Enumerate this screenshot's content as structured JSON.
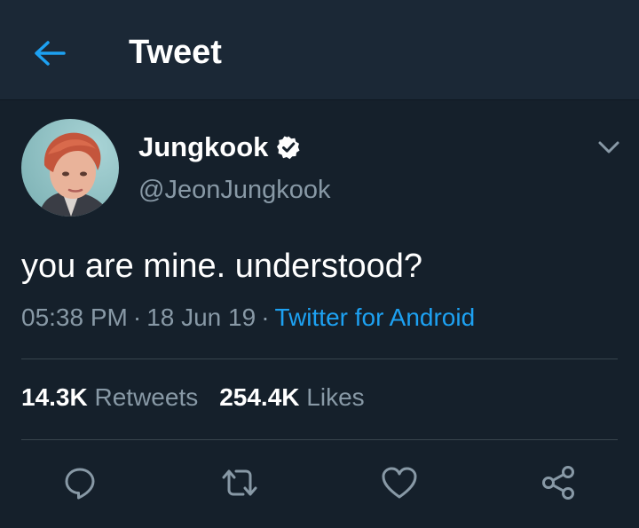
{
  "header": {
    "title": "Tweet",
    "back_icon": "arrow-left-icon"
  },
  "tweet": {
    "author": {
      "display_name": "Jungkook",
      "handle": "@JeonJungkook",
      "verified": true
    },
    "text": "you are mine. understood?",
    "time": "05:38 PM",
    "date": "18 Jun 19",
    "separator": "·",
    "source": "Twitter for Android",
    "stats": {
      "retweets_count": "14.3K",
      "retweets_label": "Retweets",
      "likes_count": "254.4K",
      "likes_label": "Likes"
    }
  },
  "actions": [
    "reply-icon",
    "retweet-icon",
    "like-icon",
    "share-icon"
  ],
  "colors": {
    "background": "#15202b",
    "header_background": "#1b2836",
    "accent": "#1da1f2",
    "secondary_text": "#8899a6",
    "divider": "#38444d"
  }
}
